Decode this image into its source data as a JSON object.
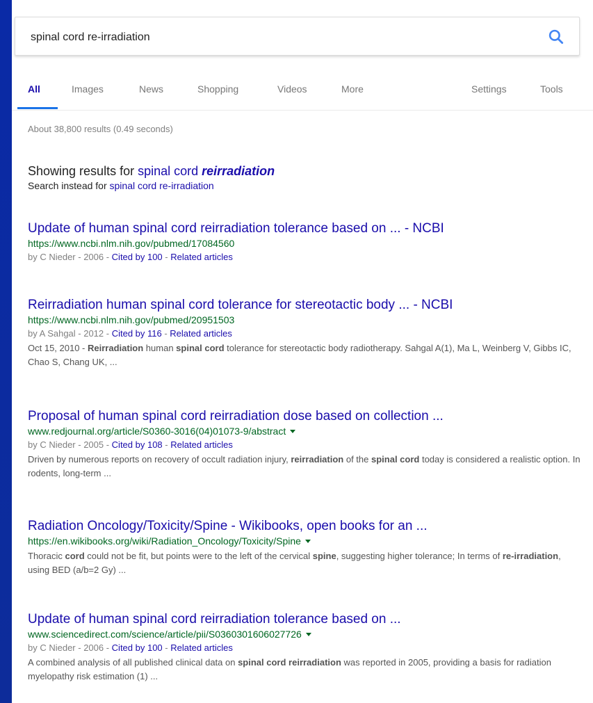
{
  "search": {
    "query": "spinal cord re-irradiation"
  },
  "tabs": [
    {
      "label": "All"
    },
    {
      "label": "Images"
    },
    {
      "label": "News"
    },
    {
      "label": "Shopping"
    },
    {
      "label": "Videos"
    },
    {
      "label": "More"
    },
    {
      "label": "Settings"
    },
    {
      "label": "Tools"
    }
  ],
  "stats": "About 38,800 results (0.49 seconds)",
  "spell": {
    "showing_prefix": "Showing results for ",
    "corrected_plain": "spinal cord ",
    "corrected_bold": "reirradiation",
    "instead_prefix": "Search instead for ",
    "instead_query": "spinal cord re-irradiation"
  },
  "results": [
    {
      "title": "Update of human spinal cord reirradiation tolerance based on ... - NCBI",
      "url": "https://www.ncbi.nlm.nih.gov/pubmed/17084560",
      "meta_prefix": "by C Nieder - 2006 - ",
      "cited": "Cited by 100",
      "sep": " - ",
      "related": "Related articles"
    },
    {
      "title": "Reirradiation human spinal cord tolerance for stereotactic body ... - NCBI",
      "url": "https://www.ncbi.nlm.nih.gov/pubmed/20951503",
      "meta_prefix": "by A Sahgal - 2012 - ",
      "cited": "Cited by 116",
      "sep": " - ",
      "related": "Related articles",
      "snippet_date": "Oct 15, 2010 - ",
      "snippet_b1": "Reirradiation",
      "snippet_t1": " human ",
      "snippet_b2": "spinal cord",
      "snippet_t2": " tolerance for stereotactic body radiotherapy. Sahgal A(1), Ma L, Weinberg V, Gibbs IC, Chao S, Chang UK, ..."
    },
    {
      "title": "Proposal of human spinal cord reirradiation dose based on collection ...",
      "url": "www.redjournal.org/article/S0360-3016(04)01073-9/abstract",
      "meta_prefix": "by C Nieder - 2005 - ",
      "cited": "Cited by 108",
      "sep": " - ",
      "related": "Related articles",
      "snippet_t0": "Driven by numerous reports on recovery of occult radiation injury, ",
      "snippet_b1": "reirradiation",
      "snippet_t1": " of the ",
      "snippet_b2": "spinal cord",
      "snippet_t2": " today is considered a realistic option. In rodents, long-term ..."
    },
    {
      "title": "Radiation Oncology/Toxicity/Spine - Wikibooks, open books for an ...",
      "url": "https://en.wikibooks.org/wiki/Radiation_Oncology/Toxicity/Spine",
      "snippet_t0": "Thoracic ",
      "snippet_b1": "cord",
      "snippet_t1": " could not be fit, but points were to the left of the cervical ",
      "snippet_b2": "spine",
      "snippet_t2": ", suggesting higher tolerance; In terms of ",
      "snippet_b3": "re-irradiation",
      "snippet_t3": ", using BED (a/b=2 Gy) ..."
    },
    {
      "title": "Update of human spinal cord reirradiation tolerance based on ...",
      "url": "www.sciencedirect.com/science/article/pii/S0360301606027726",
      "meta_prefix": "by C Nieder - 2006 - ",
      "cited": "Cited by 100",
      "sep": " - ",
      "related": "Related articles",
      "snippet_t0": "A combined analysis of all published clinical data on ",
      "snippet_b1": "spinal cord reirradiation",
      "snippet_t1": " was reported in 2005, providing a basis for radiation myelopathy risk estimation (1) ..."
    }
  ],
  "colors": {
    "link": "#1a0dab",
    "url": "#006621",
    "meta": "#808080",
    "accent": "#1a73e8",
    "background": "#0b2a9e"
  }
}
